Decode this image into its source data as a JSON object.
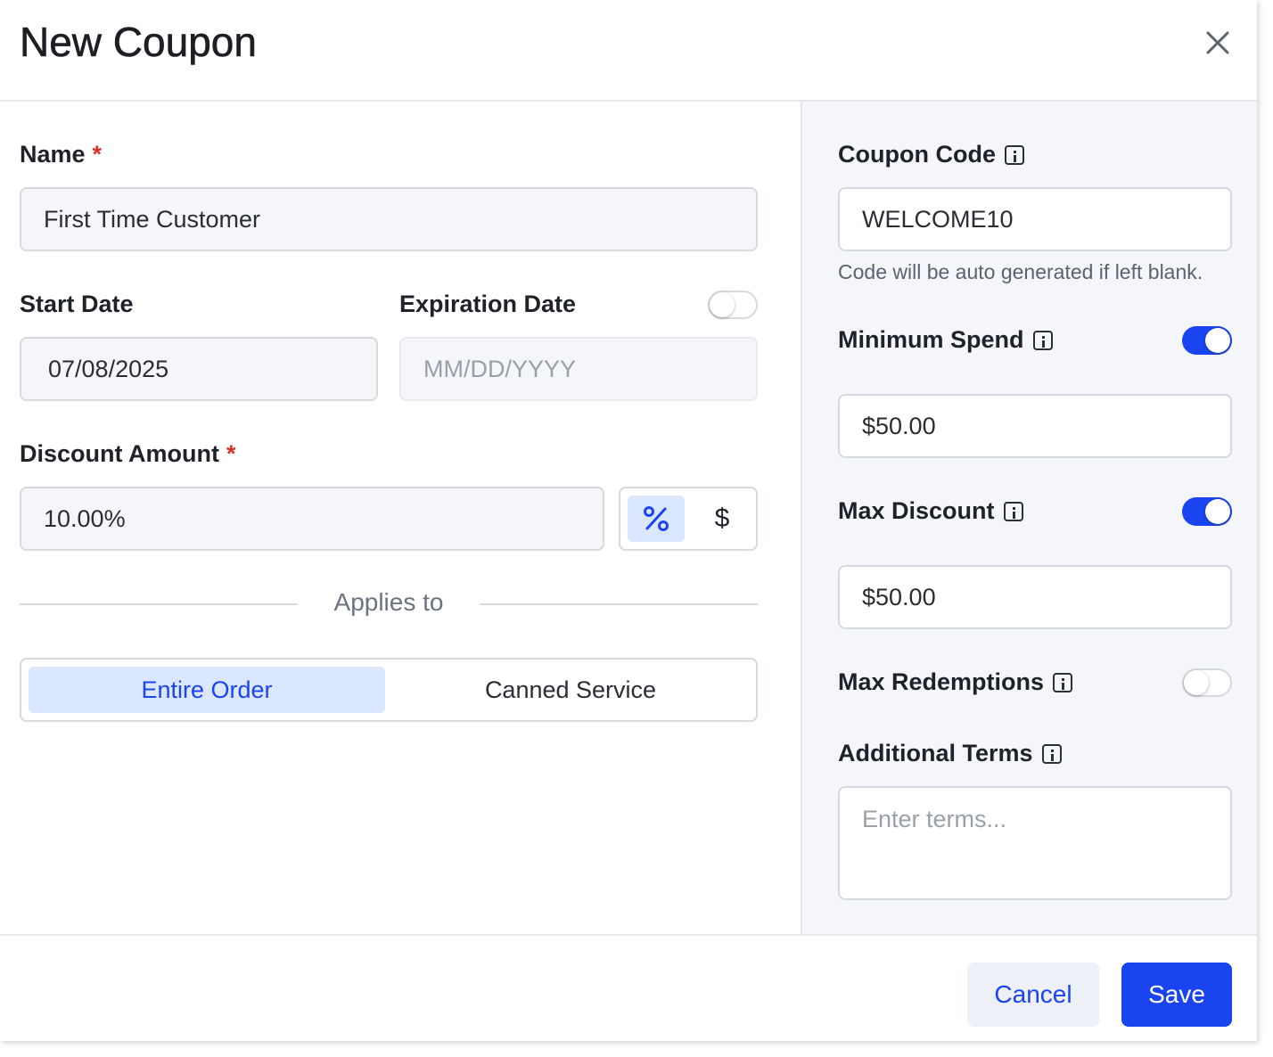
{
  "dialog": {
    "title": "New Coupon"
  },
  "form": {
    "name": {
      "label": "Name",
      "required_mark": "*",
      "value": "First Time Customer"
    },
    "start_date": {
      "label": "Start Date",
      "value": "07/08/2025"
    },
    "expiration_date": {
      "label": "Expiration Date",
      "placeholder": "MM/DD/YYYY",
      "enabled": false
    },
    "discount_amount": {
      "label": "Discount Amount",
      "required_mark": "*",
      "value": "10.00%",
      "unit_options": [
        "%",
        "$"
      ],
      "selected_unit": "%"
    },
    "applies_to": {
      "label": "Applies to",
      "options": [
        "Entire Order",
        "Canned Service"
      ],
      "selected": "Entire Order"
    }
  },
  "sidebar": {
    "coupon_code": {
      "label": "Coupon Code",
      "value": "WELCOME10",
      "hint": "Code will be auto generated if left blank."
    },
    "minimum_spend": {
      "label": "Minimum Spend",
      "enabled": true,
      "value": "$50.00"
    },
    "max_discount": {
      "label": "Max Discount",
      "enabled": true,
      "value": "$50.00"
    },
    "max_redemptions": {
      "label": "Max Redemptions",
      "enabled": false
    },
    "additional_terms": {
      "label": "Additional Terms",
      "placeholder": "Enter terms..."
    }
  },
  "footer": {
    "cancel_label": "Cancel",
    "save_label": "Save"
  },
  "colors": {
    "accent": "#1a44f0",
    "selected_bg": "#dbe7ff",
    "required": "#d93025"
  }
}
